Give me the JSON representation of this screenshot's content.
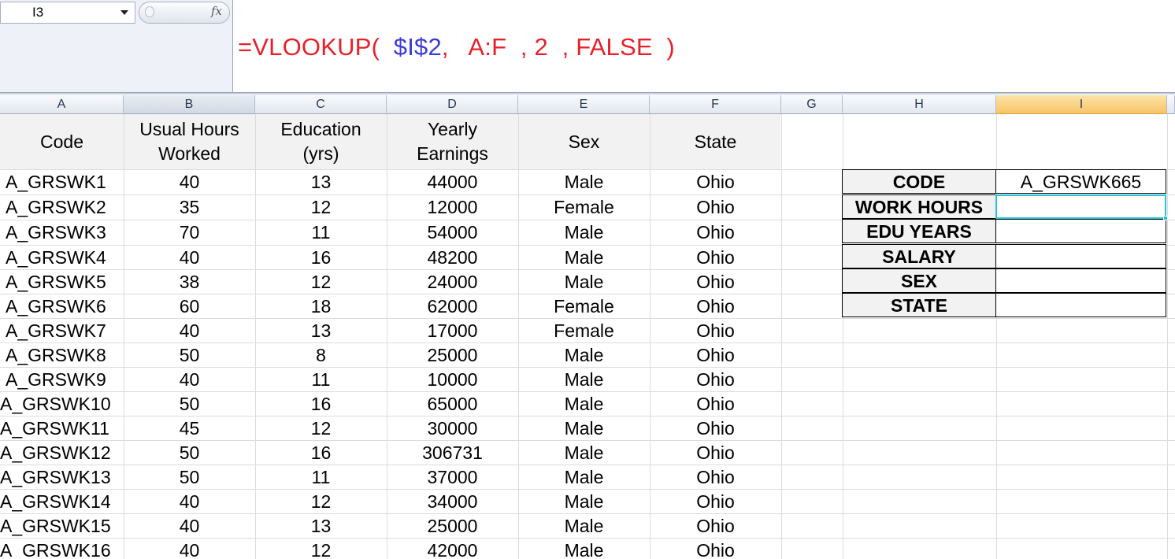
{
  "name_box": {
    "value": "I3",
    "fx_label": "fx"
  },
  "formula": {
    "parts": [
      "=VLOOKUP(  ",
      "$I$2",
      ",   A:F  , 2  , FALSE  )"
    ]
  },
  "columns": [
    "A",
    "B",
    "C",
    "D",
    "E",
    "F",
    "G",
    "H",
    "I"
  ],
  "table": {
    "headers": [
      [
        "Code"
      ],
      [
        "Usual Hours",
        "Worked"
      ],
      [
        "Education",
        "(yrs)"
      ],
      [
        "Yearly",
        "Earnings"
      ],
      [
        "Sex"
      ],
      [
        "State"
      ]
    ],
    "rows": [
      [
        "A_GRSWK1",
        "40",
        "13",
        "44000",
        "Male",
        "Ohio"
      ],
      [
        "A_GRSWK2",
        "35",
        "12",
        "12000",
        "Female",
        "Ohio"
      ],
      [
        "A_GRSWK3",
        "70",
        "11",
        "54000",
        "Male",
        "Ohio"
      ],
      [
        "A_GRSWK4",
        "40",
        "16",
        "48200",
        "Male",
        "Ohio"
      ],
      [
        "A_GRSWK5",
        "38",
        "12",
        "24000",
        "Male",
        "Ohio"
      ],
      [
        "A_GRSWK6",
        "60",
        "18",
        "62000",
        "Female",
        "Ohio"
      ],
      [
        "A_GRSWK7",
        "40",
        "13",
        "17000",
        "Female",
        "Ohio"
      ],
      [
        "A_GRSWK8",
        "50",
        "8",
        "25000",
        "Male",
        "Ohio"
      ],
      [
        "A_GRSWK9",
        "40",
        "11",
        "10000",
        "Male",
        "Ohio"
      ],
      [
        "A_GRSWK10",
        "50",
        "16",
        "65000",
        "Male",
        "Ohio"
      ],
      [
        "A_GRSWK11",
        "45",
        "12",
        "30000",
        "Male",
        "Ohio"
      ],
      [
        "A_GRSWK12",
        "50",
        "16",
        "306731",
        "Male",
        "Ohio"
      ],
      [
        "A_GRSWK13",
        "50",
        "11",
        "37000",
        "Male",
        "Ohio"
      ],
      [
        "A_GRSWK14",
        "40",
        "12",
        "34000",
        "Male",
        "Ohio"
      ],
      [
        "A_GRSWK15",
        "40",
        "13",
        "25000",
        "Male",
        "Ohio"
      ],
      [
        "A_GRSWK16",
        "40",
        "12",
        "42000",
        "Male",
        "Ohio"
      ]
    ]
  },
  "lookup": {
    "labels": [
      "CODE",
      "WORK HOURS",
      "EDU YEARS",
      "SALARY",
      "SEX",
      "STATE"
    ],
    "values": [
      "A_GRSWK665",
      "",
      "",
      "",
      "",
      ""
    ]
  },
  "colors": {
    "formula_text": "#e8202a",
    "formula_ref": "#3b3bd8",
    "active_cell_border": "#26c2d8",
    "selected_column_header": "#f7c468"
  }
}
